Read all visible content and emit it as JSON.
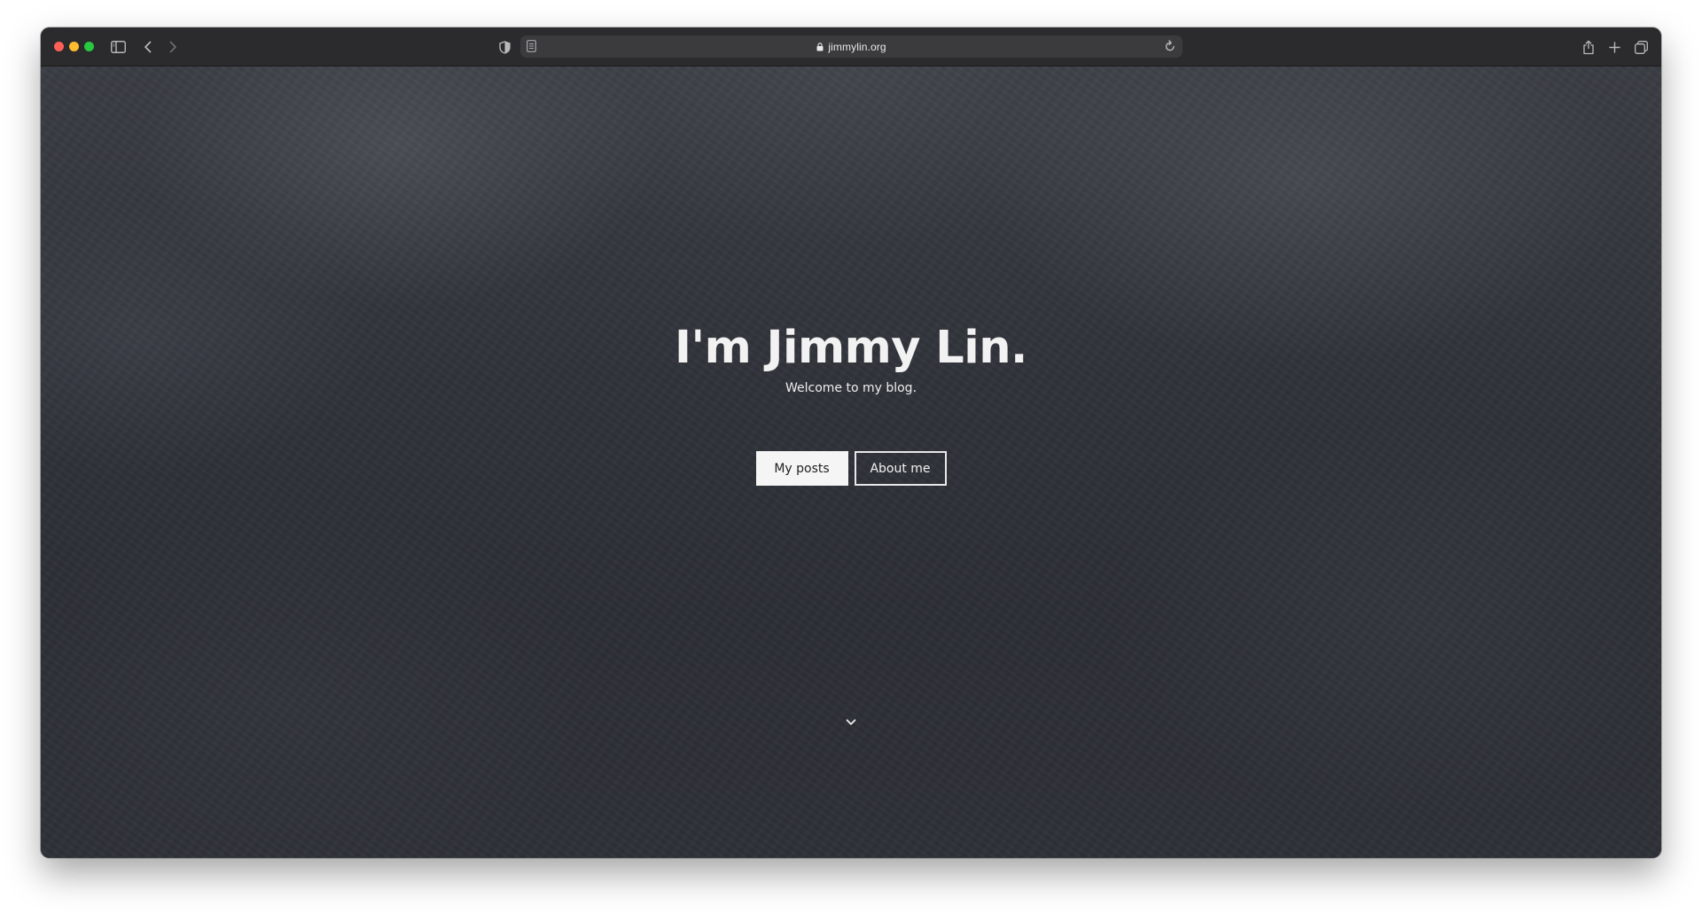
{
  "browser": {
    "url": "jimmylin.org",
    "traffic_lights": {
      "close": "#ff5f57",
      "minimize": "#febc2e",
      "maximize": "#28c840"
    },
    "icons": [
      "sidebar-icon",
      "back-icon",
      "forward-icon",
      "privacy-shield-icon",
      "reader-icon",
      "lock-icon",
      "reload-icon",
      "share-icon",
      "new-tab-icon",
      "tab-overview-icon"
    ]
  },
  "hero": {
    "title": "I'm Jimmy Lin.",
    "subtitle": "Welcome to my blog.",
    "primary_button": "My posts",
    "secondary_button": "About me",
    "scroll_icon": "chevron-down-icon"
  }
}
